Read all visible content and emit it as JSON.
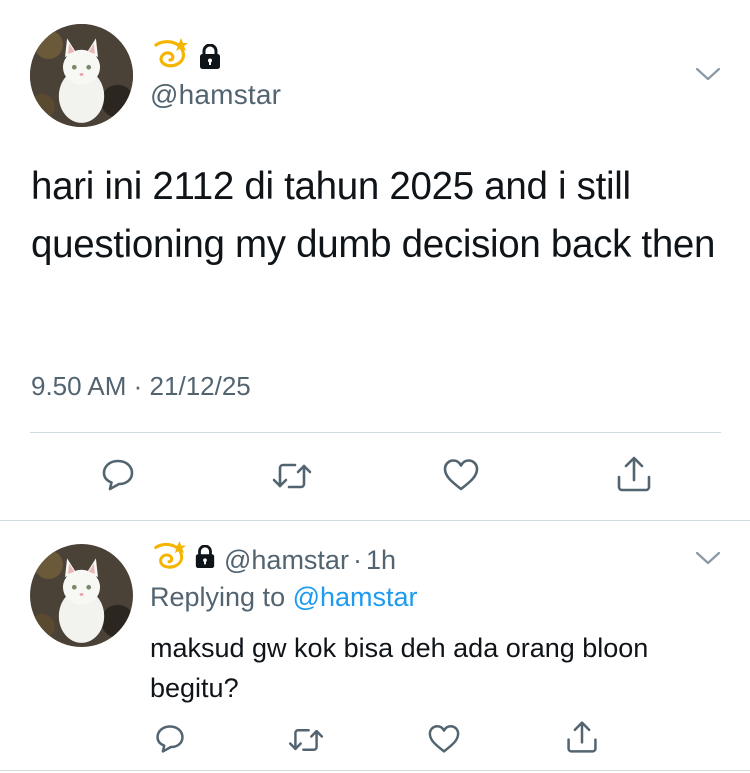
{
  "main_tweet": {
    "handle": "@hamstar",
    "text": "hari ini 2112 di tahun 2025 and i still questioning my dumb decision back then",
    "time": "9.50 AM",
    "separator": "·",
    "date": "21/12/25",
    "name_emojis": [
      "dizzy-icon",
      "lock-icon"
    ]
  },
  "actions": {
    "icons": [
      "reply-icon",
      "retweet-icon",
      "like-icon",
      "share-icon"
    ]
  },
  "reply_tweet": {
    "handle": "@hamstar",
    "separator": "·",
    "time_ago": "1h",
    "replying_prefix": "Replying to",
    "replying_to": "@hamstar",
    "text": "maksud gw kok bisa deh ada orang bloon begitu?"
  },
  "colors": {
    "text": "#0f1419",
    "secondary": "#536471",
    "link": "#1d9bf0",
    "divider": "#cfd9de"
  }
}
